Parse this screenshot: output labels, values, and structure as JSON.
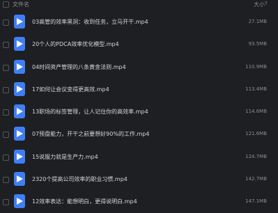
{
  "header": {
    "name_label": "文件名",
    "size_label": "大小",
    "sort_glyph": "↑"
  },
  "files": [
    {
      "name": "03高管的效率黑洞：收到任务，立马开干.mp4",
      "size": "27.1MB"
    },
    {
      "name": "20个人的PDCA效率优化模型.mp4",
      "size": "93.5MB"
    },
    {
      "name": "04时间资产管理的八条黄金法则.mp4",
      "size": "110.9MB"
    },
    {
      "name": "17如何让会议变得更高效.mp4",
      "size": "113.4MB"
    },
    {
      "name": "13职场的标签管理，让人记住你的高效率.mp4",
      "size": "114.6MB"
    },
    {
      "name": "07预盘能力，开干之前要想好90%的工作.mp4",
      "size": "121.6MB"
    },
    {
      "name": "15说服力就是生产力.mp4",
      "size": "124.7MB"
    },
    {
      "name": "2320个提高公司效率的职业习惯.mp4",
      "size": "142.7MB"
    },
    {
      "name": "12效率表达：能想明白，更得说明白.mp4",
      "size": "147.1MB"
    }
  ]
}
